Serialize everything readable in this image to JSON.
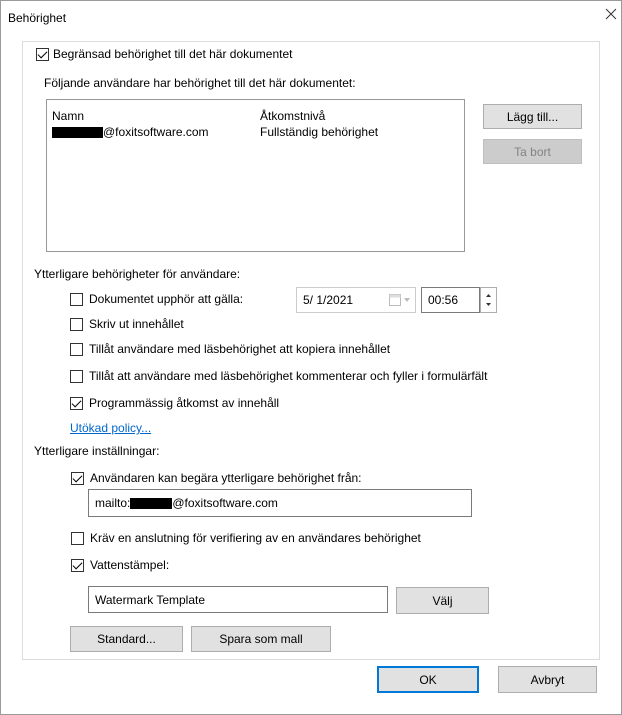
{
  "window": {
    "title": "Behörighet"
  },
  "restrict": {
    "label": "Begränsad behörighet till det här dokumentet",
    "checked": true
  },
  "users_heading": "Följande användare har behörighet till det här dokumentet:",
  "table": {
    "headers": [
      "Namn",
      "Åtkomstnivå"
    ],
    "rows": [
      {
        "name_suffix": "@foxitsoftware.com",
        "level": "Fullständig behörighet"
      }
    ]
  },
  "buttons": {
    "add": "Lägg till...",
    "remove": "Ta bort",
    "choose": "Välj",
    "standard": "Standard...",
    "save_template": "Spara som mall",
    "ok": "OK",
    "cancel": "Avbryt"
  },
  "extra_heading": "Ytterligare behörigheter för användare:",
  "expire": {
    "label": "Dokumentet upphör att gälla:",
    "date": "5/ 1/2021",
    "time": "00:56",
    "checked": false
  },
  "print": {
    "label": "Skriv ut innehållet",
    "checked": false
  },
  "copy": {
    "label": "Tillåt användare med läsbehörighet att kopiera innehållet",
    "checked": false
  },
  "comment": {
    "label": "Tillåt att användare med läsbehörighet kommenterar och fyller i formulärfält",
    "checked": false
  },
  "programmatic": {
    "label": "Programmässig åtkomst av innehåll",
    "checked": true
  },
  "extended_policy": "Utökad policy...",
  "settings_heading": "Ytterligare inställningar:",
  "request": {
    "label": "Användaren kan begära ytterligare behörighet från:",
    "checked": true,
    "prefix": "mailto:",
    "suffix": "@foxitsoftware.com"
  },
  "verify": {
    "label": "Kräv en anslutning för verifiering av en användares behörighet",
    "checked": false
  },
  "watermark": {
    "label": "Vattenstämpel:",
    "checked": true,
    "value": "Watermark Template"
  }
}
